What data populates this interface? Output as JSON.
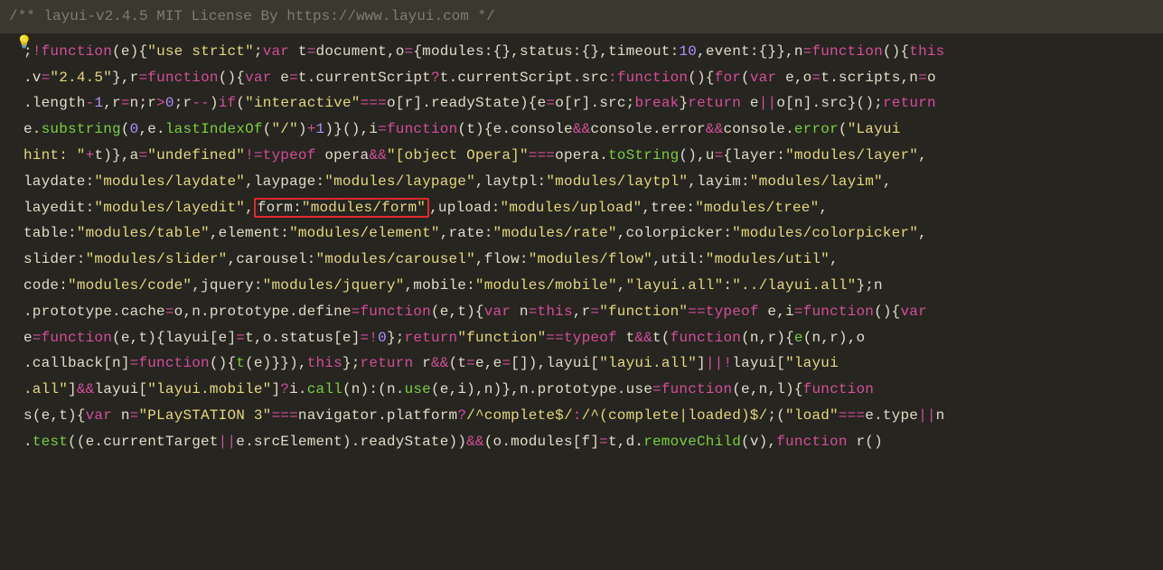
{
  "comment": "/** layui-v2.4.5 MIT License By https://www.layui.com */",
  "tokens": [
    {
      "t": ";",
      "c": "c-punc"
    },
    {
      "t": "!",
      "c": "c-op"
    },
    {
      "t": "function",
      "c": "c-keyword"
    },
    {
      "t": "(e){",
      "c": "c-punc"
    },
    {
      "t": "\"use strict\"",
      "c": "c-string"
    },
    {
      "t": ";",
      "c": "c-punc"
    },
    {
      "t": "var",
      "c": "c-keyword"
    },
    {
      "t": " t",
      "c": "c-ident"
    },
    {
      "t": "=",
      "c": "c-op"
    },
    {
      "t": "document,o",
      "c": "c-ident"
    },
    {
      "t": "=",
      "c": "c-op"
    },
    {
      "t": "{modules:{},status:{},timeout:",
      "c": "c-ident"
    },
    {
      "t": "10",
      "c": "c-number"
    },
    {
      "t": ",event:{}},n",
      "c": "c-ident"
    },
    {
      "t": "=",
      "c": "c-op"
    },
    {
      "t": "function",
      "c": "c-keyword"
    },
    {
      "t": "(){",
      "c": "c-punc"
    },
    {
      "t": "this",
      "c": "c-keyword"
    },
    {
      "t": "\n.v",
      "c": "c-ident"
    },
    {
      "t": "=",
      "c": "c-op"
    },
    {
      "t": "\"2.4.5\"",
      "c": "c-string"
    },
    {
      "t": "},r",
      "c": "c-ident"
    },
    {
      "t": "=",
      "c": "c-op"
    },
    {
      "t": "function",
      "c": "c-keyword"
    },
    {
      "t": "(){",
      "c": "c-punc"
    },
    {
      "t": "var",
      "c": "c-keyword"
    },
    {
      "t": " e",
      "c": "c-ident"
    },
    {
      "t": "=",
      "c": "c-op"
    },
    {
      "t": "t.currentScript",
      "c": "c-ident"
    },
    {
      "t": "?",
      "c": "c-op"
    },
    {
      "t": "t.currentScript.src",
      "c": "c-ident"
    },
    {
      "t": ":",
      "c": "c-op"
    },
    {
      "t": "function",
      "c": "c-keyword"
    },
    {
      "t": "(){",
      "c": "c-punc"
    },
    {
      "t": "for",
      "c": "c-keyword"
    },
    {
      "t": "(",
      "c": "c-punc"
    },
    {
      "t": "var",
      "c": "c-keyword"
    },
    {
      "t": " e,o",
      "c": "c-ident"
    },
    {
      "t": "=",
      "c": "c-op"
    },
    {
      "t": "t.scripts,n",
      "c": "c-ident"
    },
    {
      "t": "=",
      "c": "c-op"
    },
    {
      "t": "o",
      "c": "c-ident"
    },
    {
      "t": "\n.length",
      "c": "c-ident"
    },
    {
      "t": "-",
      "c": "c-op"
    },
    {
      "t": "1",
      "c": "c-number"
    },
    {
      "t": ",r",
      "c": "c-ident"
    },
    {
      "t": "=",
      "c": "c-op"
    },
    {
      "t": "n;r",
      "c": "c-ident"
    },
    {
      "t": ">",
      "c": "c-op"
    },
    {
      "t": "0",
      "c": "c-number"
    },
    {
      "t": ";r",
      "c": "c-ident"
    },
    {
      "t": "--",
      "c": "c-op"
    },
    {
      "t": ")",
      "c": "c-punc"
    },
    {
      "t": "if",
      "c": "c-keyword"
    },
    {
      "t": "(",
      "c": "c-punc"
    },
    {
      "t": "\"interactive\"",
      "c": "c-string"
    },
    {
      "t": "===",
      "c": "c-op"
    },
    {
      "t": "o[r].readyState){e",
      "c": "c-ident"
    },
    {
      "t": "=",
      "c": "c-op"
    },
    {
      "t": "o[r].src;",
      "c": "c-ident"
    },
    {
      "t": "break",
      "c": "c-keyword"
    },
    {
      "t": "}",
      "c": "c-punc"
    },
    {
      "t": "return",
      "c": "c-keyword"
    },
    {
      "t": " e",
      "c": "c-ident"
    },
    {
      "t": "||",
      "c": "c-op"
    },
    {
      "t": "o[n].src}();",
      "c": "c-ident"
    },
    {
      "t": "return",
      "c": "c-keyword"
    },
    {
      "t": "\ne.",
      "c": "c-ident"
    },
    {
      "t": "substring",
      "c": "c-func"
    },
    {
      "t": "(",
      "c": "c-punc"
    },
    {
      "t": "0",
      "c": "c-number"
    },
    {
      "t": ",e.",
      "c": "c-ident"
    },
    {
      "t": "lastIndexOf",
      "c": "c-func"
    },
    {
      "t": "(",
      "c": "c-punc"
    },
    {
      "t": "\"/\"",
      "c": "c-string"
    },
    {
      "t": ")",
      "c": "c-punc"
    },
    {
      "t": "+",
      "c": "c-op"
    },
    {
      "t": "1",
      "c": "c-number"
    },
    {
      "t": ")}(),i",
      "c": "c-ident"
    },
    {
      "t": "=",
      "c": "c-op"
    },
    {
      "t": "function",
      "c": "c-keyword"
    },
    {
      "t": "(t){e.console",
      "c": "c-ident"
    },
    {
      "t": "&&",
      "c": "c-op"
    },
    {
      "t": "console.error",
      "c": "c-ident"
    },
    {
      "t": "&&",
      "c": "c-op"
    },
    {
      "t": "console.",
      "c": "c-ident"
    },
    {
      "t": "error",
      "c": "c-func"
    },
    {
      "t": "(",
      "c": "c-punc"
    },
    {
      "t": "\"Layui ",
      "c": "c-string"
    },
    {
      "t": "\nhint: \"",
      "c": "c-string"
    },
    {
      "t": "+",
      "c": "c-op"
    },
    {
      "t": "t)},a",
      "c": "c-ident"
    },
    {
      "t": "=",
      "c": "c-op"
    },
    {
      "t": "\"undefined\"",
      "c": "c-string"
    },
    {
      "t": "!=",
      "c": "c-op"
    },
    {
      "t": "typeof",
      "c": "c-keyword"
    },
    {
      "t": " opera",
      "c": "c-ident"
    },
    {
      "t": "&&",
      "c": "c-op"
    },
    {
      "t": "\"[object Opera]\"",
      "c": "c-string"
    },
    {
      "t": "===",
      "c": "c-op"
    },
    {
      "t": "opera.",
      "c": "c-ident"
    },
    {
      "t": "toString",
      "c": "c-func"
    },
    {
      "t": "(),u",
      "c": "c-ident"
    },
    {
      "t": "=",
      "c": "c-op"
    },
    {
      "t": "{layer:",
      "c": "c-ident"
    },
    {
      "t": "\"modules/layer\"",
      "c": "c-string"
    },
    {
      "t": ",",
      "c": "c-punc"
    },
    {
      "t": "\nlaydate:",
      "c": "c-ident"
    },
    {
      "t": "\"modules/laydate\"",
      "c": "c-string"
    },
    {
      "t": ",laypage:",
      "c": "c-ident"
    },
    {
      "t": "\"modules/laypage\"",
      "c": "c-string"
    },
    {
      "t": ",laytpl:",
      "c": "c-ident"
    },
    {
      "t": "\"modules/laytpl\"",
      "c": "c-string"
    },
    {
      "t": ",layim:",
      "c": "c-ident"
    },
    {
      "t": "\"modules/layim\"",
      "c": "c-string"
    },
    {
      "t": ",",
      "c": "c-punc"
    },
    {
      "t": "\nlayedit:",
      "c": "c-ident"
    },
    {
      "t": "\"modules/layedit\"",
      "c": "c-string"
    },
    {
      "t": ",",
      "c": "c-punc"
    },
    {
      "t": "form:",
      "c": "c-ident",
      "box": true
    },
    {
      "t": "\"modules/form\"",
      "c": "c-string",
      "box": true
    },
    {
      "t": ",upload:",
      "c": "c-ident"
    },
    {
      "t": "\"modules/upload\"",
      "c": "c-string"
    },
    {
      "t": ",tree:",
      "c": "c-ident"
    },
    {
      "t": "\"modules/tree\"",
      "c": "c-string"
    },
    {
      "t": ",",
      "c": "c-punc"
    },
    {
      "t": "\ntable:",
      "c": "c-ident"
    },
    {
      "t": "\"modules/table\"",
      "c": "c-string"
    },
    {
      "t": ",element:",
      "c": "c-ident"
    },
    {
      "t": "\"modules/element\"",
      "c": "c-string"
    },
    {
      "t": ",rate:",
      "c": "c-ident"
    },
    {
      "t": "\"modules/rate\"",
      "c": "c-string"
    },
    {
      "t": ",colorpicker:",
      "c": "c-ident"
    },
    {
      "t": "\"modules/colorpicker\"",
      "c": "c-string"
    },
    {
      "t": ",",
      "c": "c-punc"
    },
    {
      "t": "\nslider:",
      "c": "c-ident"
    },
    {
      "t": "\"modules/slider\"",
      "c": "c-string"
    },
    {
      "t": ",carousel:",
      "c": "c-ident"
    },
    {
      "t": "\"modules/carousel\"",
      "c": "c-string"
    },
    {
      "t": ",flow:",
      "c": "c-ident"
    },
    {
      "t": "\"modules/flow\"",
      "c": "c-string"
    },
    {
      "t": ",util:",
      "c": "c-ident"
    },
    {
      "t": "\"modules/util\"",
      "c": "c-string"
    },
    {
      "t": ",",
      "c": "c-punc"
    },
    {
      "t": "\ncode:",
      "c": "c-ident"
    },
    {
      "t": "\"modules/code\"",
      "c": "c-string"
    },
    {
      "t": ",jquery:",
      "c": "c-ident"
    },
    {
      "t": "\"modules/jquery\"",
      "c": "c-string"
    },
    {
      "t": ",mobile:",
      "c": "c-ident"
    },
    {
      "t": "\"modules/mobile\"",
      "c": "c-string"
    },
    {
      "t": ",",
      "c": "c-punc"
    },
    {
      "t": "\"layui.all\"",
      "c": "c-string"
    },
    {
      "t": ":",
      "c": "c-punc"
    },
    {
      "t": "\"../layui.all\"",
      "c": "c-string"
    },
    {
      "t": "};n",
      "c": "c-ident"
    },
    {
      "t": "\n.prototype.cache",
      "c": "c-ident"
    },
    {
      "t": "=",
      "c": "c-op"
    },
    {
      "t": "o,n.prototype.define",
      "c": "c-ident"
    },
    {
      "t": "=",
      "c": "c-op"
    },
    {
      "t": "function",
      "c": "c-keyword"
    },
    {
      "t": "(e,t){",
      "c": "c-punc"
    },
    {
      "t": "var",
      "c": "c-keyword"
    },
    {
      "t": " n",
      "c": "c-ident"
    },
    {
      "t": "=",
      "c": "c-op"
    },
    {
      "t": "this",
      "c": "c-keyword"
    },
    {
      "t": ",r",
      "c": "c-ident"
    },
    {
      "t": "=",
      "c": "c-op"
    },
    {
      "t": "\"function\"",
      "c": "c-string"
    },
    {
      "t": "==",
      "c": "c-op"
    },
    {
      "t": "typeof",
      "c": "c-keyword"
    },
    {
      "t": " e,i",
      "c": "c-ident"
    },
    {
      "t": "=",
      "c": "c-op"
    },
    {
      "t": "function",
      "c": "c-keyword"
    },
    {
      "t": "(){",
      "c": "c-punc"
    },
    {
      "t": "var",
      "c": "c-keyword"
    },
    {
      "t": "\ne",
      "c": "c-ident"
    },
    {
      "t": "=",
      "c": "c-op"
    },
    {
      "t": "function",
      "c": "c-keyword"
    },
    {
      "t": "(e,t){layui[e]",
      "c": "c-ident"
    },
    {
      "t": "=",
      "c": "c-op"
    },
    {
      "t": "t,o.status[e]",
      "c": "c-ident"
    },
    {
      "t": "=!",
      "c": "c-op"
    },
    {
      "t": "0",
      "c": "c-number"
    },
    {
      "t": "};",
      "c": "c-punc"
    },
    {
      "t": "return",
      "c": "c-keyword"
    },
    {
      "t": "\"function\"",
      "c": "c-string"
    },
    {
      "t": "==",
      "c": "c-op"
    },
    {
      "t": "typeof",
      "c": "c-keyword"
    },
    {
      "t": " t",
      "c": "c-ident"
    },
    {
      "t": "&&",
      "c": "c-op"
    },
    {
      "t": "t",
      "c": "c-ident"
    },
    {
      "t": "(",
      "c": "c-punc"
    },
    {
      "t": "function",
      "c": "c-keyword"
    },
    {
      "t": "(n,r){",
      "c": "c-punc"
    },
    {
      "t": "e",
      "c": "c-func"
    },
    {
      "t": "(n,r),o",
      "c": "c-ident"
    },
    {
      "t": "\n.callback[n]",
      "c": "c-ident"
    },
    {
      "t": "=",
      "c": "c-op"
    },
    {
      "t": "function",
      "c": "c-keyword"
    },
    {
      "t": "(){",
      "c": "c-punc"
    },
    {
      "t": "t",
      "c": "c-func"
    },
    {
      "t": "(e)}}),",
      "c": "c-ident"
    },
    {
      "t": "this",
      "c": "c-keyword"
    },
    {
      "t": "};",
      "c": "c-punc"
    },
    {
      "t": "return",
      "c": "c-keyword"
    },
    {
      "t": " r",
      "c": "c-ident"
    },
    {
      "t": "&&",
      "c": "c-op"
    },
    {
      "t": "(t",
      "c": "c-ident"
    },
    {
      "t": "=",
      "c": "c-op"
    },
    {
      "t": "e,e",
      "c": "c-ident"
    },
    {
      "t": "=",
      "c": "c-op"
    },
    {
      "t": "[]),layui[",
      "c": "c-ident"
    },
    {
      "t": "\"layui.all\"",
      "c": "c-string"
    },
    {
      "t": "]",
      "c": "c-ident"
    },
    {
      "t": "||!",
      "c": "c-op"
    },
    {
      "t": "layui[",
      "c": "c-ident"
    },
    {
      "t": "\"layui",
      "c": "c-string"
    },
    {
      "t": "\n.all\"",
      "c": "c-string"
    },
    {
      "t": "]",
      "c": "c-ident"
    },
    {
      "t": "&&",
      "c": "c-op"
    },
    {
      "t": "layui[",
      "c": "c-ident"
    },
    {
      "t": "\"layui.mobile\"",
      "c": "c-string"
    },
    {
      "t": "]",
      "c": "c-ident"
    },
    {
      "t": "?",
      "c": "c-op"
    },
    {
      "t": "i.",
      "c": "c-ident"
    },
    {
      "t": "call",
      "c": "c-func"
    },
    {
      "t": "(n):(n.",
      "c": "c-ident"
    },
    {
      "t": "use",
      "c": "c-func"
    },
    {
      "t": "(e,i),n)},n.prototype.use",
      "c": "c-ident"
    },
    {
      "t": "=",
      "c": "c-op"
    },
    {
      "t": "function",
      "c": "c-keyword"
    },
    {
      "t": "(e,n,l){",
      "c": "c-punc"
    },
    {
      "t": "function",
      "c": "c-keyword"
    },
    {
      "t": "\ns",
      "c": "c-ident"
    },
    {
      "t": "(e,t){",
      "c": "c-punc"
    },
    {
      "t": "var",
      "c": "c-keyword"
    },
    {
      "t": " n",
      "c": "c-ident"
    },
    {
      "t": "=",
      "c": "c-op"
    },
    {
      "t": "\"PLaySTATION 3\"",
      "c": "c-string"
    },
    {
      "t": "===",
      "c": "c-op"
    },
    {
      "t": "navigator.platform",
      "c": "c-ident"
    },
    {
      "t": "?",
      "c": "c-op"
    },
    {
      "t": "/^complete$/",
      "c": "c-string"
    },
    {
      "t": ":",
      "c": "c-op"
    },
    {
      "t": "/^(complete|loaded)$/",
      "c": "c-string"
    },
    {
      "t": ";(",
      "c": "c-punc"
    },
    {
      "t": "\"load\"",
      "c": "c-string"
    },
    {
      "t": "===",
      "c": "c-op"
    },
    {
      "t": "e.type",
      "c": "c-ident"
    },
    {
      "t": "||",
      "c": "c-op"
    },
    {
      "t": "n",
      "c": "c-ident"
    },
    {
      "t": "\n.",
      "c": "c-ident"
    },
    {
      "t": "test",
      "c": "c-func"
    },
    {
      "t": "((e.currentTarget",
      "c": "c-ident"
    },
    {
      "t": "||",
      "c": "c-op"
    },
    {
      "t": "e.srcElement).readyState))",
      "c": "c-ident"
    },
    {
      "t": "&&",
      "c": "c-op"
    },
    {
      "t": "(o.modules[f]",
      "c": "c-ident"
    },
    {
      "t": "=",
      "c": "c-op"
    },
    {
      "t": "t,d.",
      "c": "c-ident"
    },
    {
      "t": "removeChild",
      "c": "c-func"
    },
    {
      "t": "(v),",
      "c": "c-ident"
    },
    {
      "t": "function",
      "c": "c-keyword"
    },
    {
      "t": " r",
      "c": "c-ident"
    },
    {
      "t": "()",
      "c": "c-punc"
    }
  ]
}
